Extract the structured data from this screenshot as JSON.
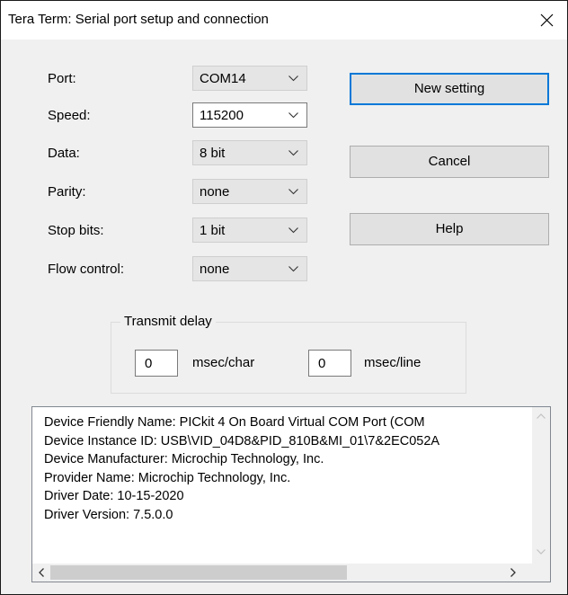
{
  "window": {
    "title": "Tera Term: Serial port setup and connection"
  },
  "fields": [
    {
      "label": "Port:",
      "value": "COM14"
    },
    {
      "label": "Speed:",
      "value": "115200"
    },
    {
      "label": "Data:",
      "value": "8 bit"
    },
    {
      "label": "Parity:",
      "value": "none"
    },
    {
      "label": "Stop bits:",
      "value": "1 bit"
    },
    {
      "label": "Flow control:",
      "value": "none"
    }
  ],
  "buttons": {
    "new_setting": "New setting",
    "cancel": "Cancel",
    "help": "Help"
  },
  "transmit_delay": {
    "label": "Transmit delay",
    "char_value": "0",
    "char_unit": "msec/char",
    "line_value": "0",
    "line_unit": "msec/line"
  },
  "device_info": [
    "Device Friendly Name: PICkit 4 On Board Virtual COM Port (COM",
    "Device Instance ID: USB\\VID_04D8&PID_810B&MI_01\\7&2EC052A",
    "Device Manufacturer: Microchip Technology, Inc.",
    "Provider Name: Microchip Technology, Inc.",
    "Driver Date: 10-15-2020",
    "Driver Version: 7.5.0.0"
  ],
  "icons": {
    "close": "close-icon",
    "dropdown": "chevron-down-icon"
  },
  "colors": {
    "accent": "#0078d7",
    "dialog_bg": "#f0f0f0"
  }
}
